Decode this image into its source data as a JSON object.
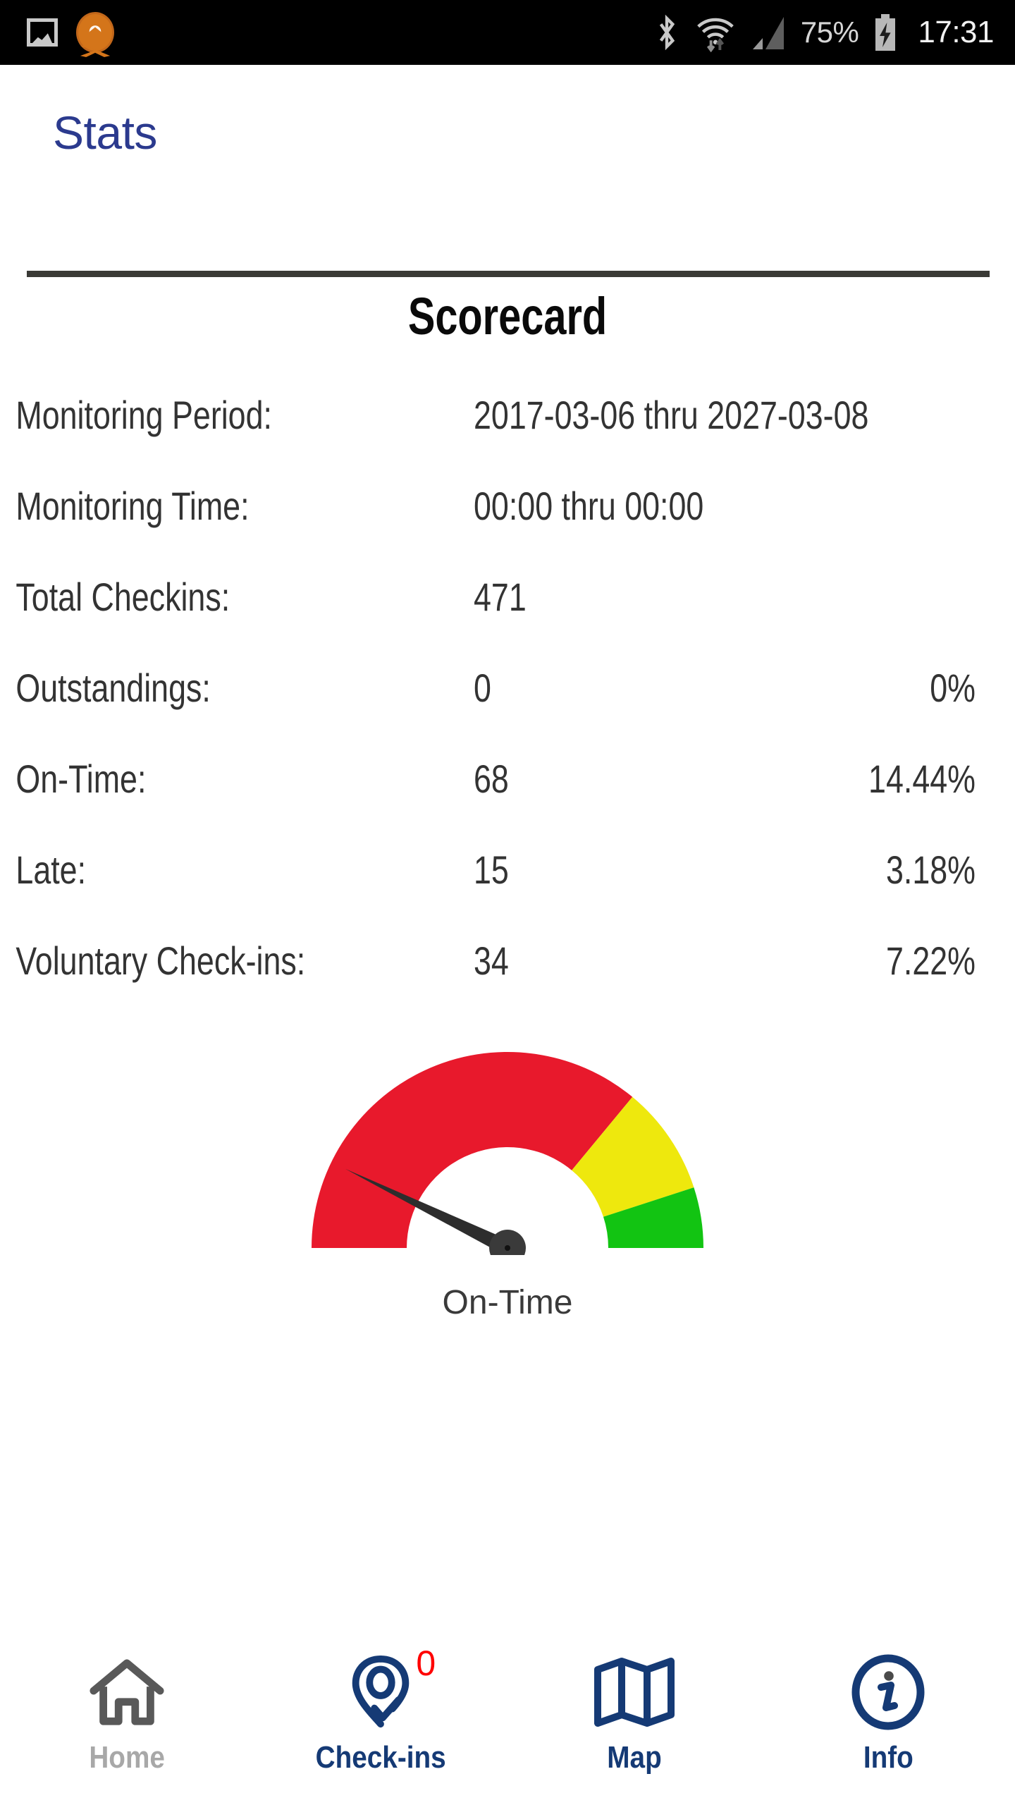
{
  "status_bar": {
    "left_icons": [
      "image-screenshot-icon",
      "ecell-app-icon"
    ],
    "bluetooth_icon": "bluetooth-icon",
    "wifi_icon": "wifi-transfer-icon",
    "signal_icon": "cellular-signal-icon",
    "battery_percent": "75%",
    "battery_icon": "battery-charging-icon",
    "clock": "17:31"
  },
  "header": {
    "title": "Stats"
  },
  "card": {
    "title": "Scorecard",
    "rows": [
      {
        "label": "Monitoring Period:",
        "value": "2017-03-06 thru 2027-03-08",
        "percent": ""
      },
      {
        "label": "Monitoring Time:",
        "value": "00:00 thru 00:00",
        "percent": ""
      },
      {
        "label": "Total Checkins:",
        "value": "471",
        "percent": ""
      },
      {
        "label": "Outstandings:",
        "value": "0",
        "percent": "0%"
      },
      {
        "label": "On-Time:",
        "value": "68",
        "percent": "14.44%"
      },
      {
        "label": "Late:",
        "value": "15",
        "percent": "3.18%"
      },
      {
        "label": "Voluntary Check-ins:",
        "value": "34",
        "percent": "7.22%"
      }
    ]
  },
  "chart_data": {
    "type": "gauge",
    "title": "",
    "label": "On-Time",
    "value": 14.44,
    "value_label": "14.44%",
    "min": 0,
    "max": 100,
    "needle_angle_deg": 154,
    "start_angle_deg": 180,
    "end_angle_deg": 0,
    "bands": [
      {
        "name": "red",
        "from": 0,
        "to": 72,
        "color": "#e8192c"
      },
      {
        "name": "yellow",
        "from": 72,
        "to": 90,
        "color": "#eee80d"
      },
      {
        "name": "green",
        "from": 90,
        "to": 100,
        "color": "#12c412"
      }
    ],
    "needle_color": "#2d2d2d",
    "hub_color": "#3a3a3a"
  },
  "tabbar": {
    "tabs": [
      {
        "id": "home",
        "label": "Home",
        "icon": "home-icon",
        "active": false,
        "badge": ""
      },
      {
        "id": "check-ins",
        "label": "Check-ins",
        "icon": "pin-check-icon",
        "active": true,
        "badge": "0"
      },
      {
        "id": "map",
        "label": "Map",
        "icon": "map-folded-icon",
        "active": true,
        "badge": ""
      },
      {
        "id": "info",
        "label": "Info",
        "icon": "info-circle-icon",
        "active": true,
        "badge": ""
      }
    ]
  },
  "colors": {
    "accent_navy": "#153a75",
    "title_blue": "#2b3a8e",
    "badge_red": "#ff0000",
    "inactive_gray": "#a8a8a8",
    "divider": "#3a3a36"
  }
}
